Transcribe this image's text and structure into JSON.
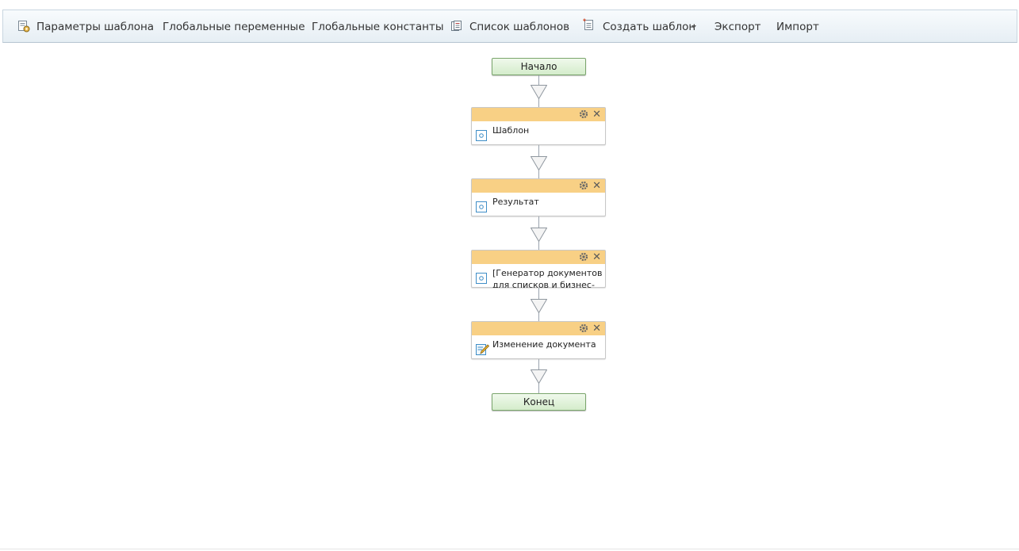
{
  "toolbar": {
    "items": [
      {
        "label": "Параметры шаблона",
        "icon": "template-settings-icon"
      },
      {
        "label": "Глобальные переменные"
      },
      {
        "label": "Глобальные константы"
      },
      {
        "label": "Список шаблонов",
        "icon": "template-list-icon"
      },
      {
        "label": "Создать шаблон",
        "icon": "create-template-icon",
        "dropdown": true
      },
      {
        "label": "Экспорт"
      },
      {
        "label": "Импорт"
      }
    ]
  },
  "workflow": {
    "start_label": "Начало",
    "end_label": "Конец",
    "nodes": [
      {
        "text": "Шаблон",
        "icon": "activity-icon"
      },
      {
        "text": "Результат",
        "icon": "activity-icon"
      },
      {
        "text": "[Генератор документов для списков и бизнес-",
        "icon": "activity-icon"
      },
      {
        "text": "Изменение документа",
        "icon": "edit-document-icon"
      }
    ],
    "node_close_glyph": "✕"
  },
  "colors": {
    "node_header": "#f8d085",
    "terminal_fill": "#d4eccb",
    "terminal_border": "#7aa56c",
    "toolbar_bg": "#e6eef4",
    "connector": "#9aa3ad"
  }
}
